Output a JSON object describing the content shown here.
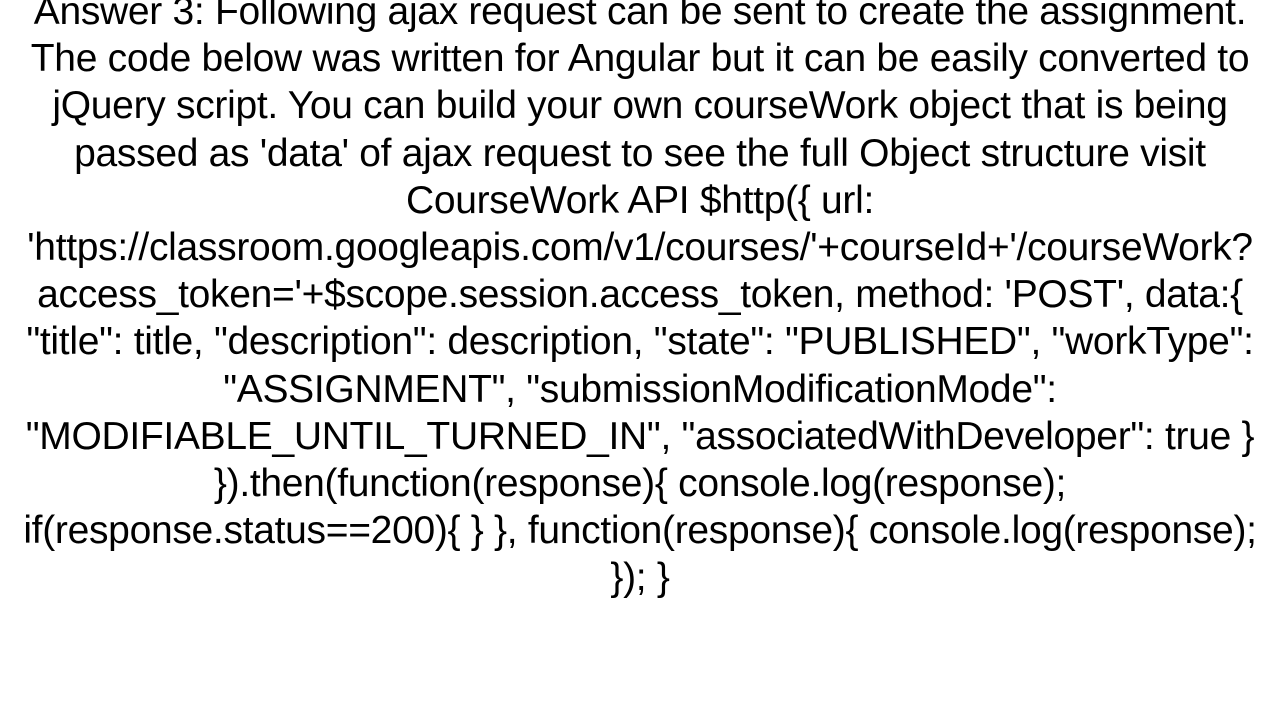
{
  "answer": {
    "text": "Answer 3: Following ajax request can be sent to create the assignment. The code below was written for Angular but it can be easily converted to jQuery script. You can build your own courseWork object that is being passed as 'data' of ajax request to see the full Object structure visit CourseWork API     $http({           url: 'https://classroom.googleapis.com/v1/courses/'+courseId+'/courseWork?access_token='+$scope.session.access_token,         method: 'POST',         data:{             \"title\": title,             \"description\": description,             \"state\": \"PUBLISHED\",             \"workType\": \"ASSIGNMENT\",             \"submissionModificationMode\": \"MODIFIABLE_UNTIL_TURNED_IN\",             \"associatedWithDeveloper\": true         }     }).then(function(response){         console.log(response);         if(response.status==200){         }      }, function(response){         console.log(response);     }); }"
  }
}
